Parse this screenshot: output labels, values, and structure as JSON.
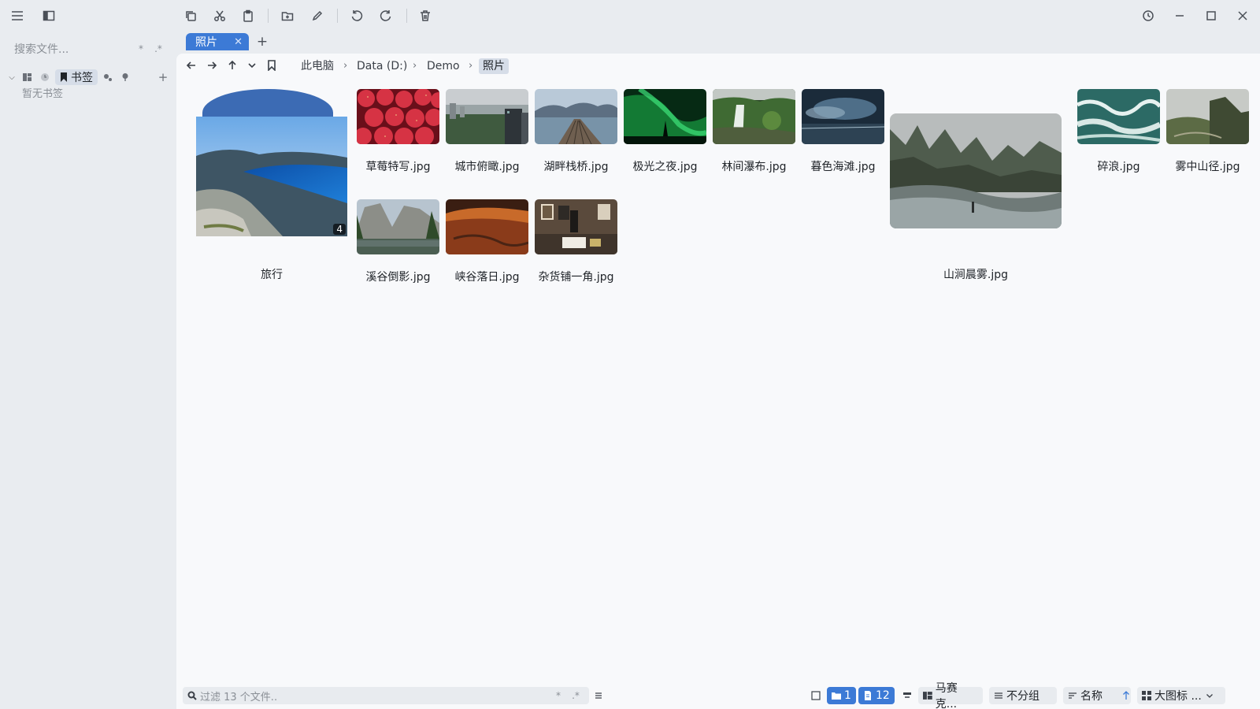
{
  "toolbar": {
    "icons": [
      "menu-icon",
      "sidebar-toggle-icon",
      "copy-icon",
      "cut-icon",
      "paste-icon",
      "new-folder-icon",
      "rename-icon",
      "undo-icon",
      "redo-icon",
      "delete-icon",
      "history-icon",
      "minimize-icon",
      "maximize-icon",
      "close-icon"
    ]
  },
  "sidebar": {
    "search_placeholder": "搜索文件...",
    "search_opt_wildcard": "*",
    "search_opt_regex": ".*",
    "bookmark_chip": "书签",
    "add": "+",
    "empty_text": "暂无书签"
  },
  "tabs": [
    {
      "label": "照片",
      "close": "✕"
    }
  ],
  "tab_add": "+",
  "breadcrumb": [
    "此电脑",
    "Data (D:)",
    "Demo",
    "照片"
  ],
  "breadcrumb_sep": "›",
  "files": [
    {
      "name": "旅行",
      "type": "folder",
      "count": "4"
    },
    {
      "name": "草莓特写.jpg"
    },
    {
      "name": "城市俯瞰.jpg"
    },
    {
      "name": "湖畔栈桥.jpg"
    },
    {
      "name": "极光之夜.jpg"
    },
    {
      "name": "林间瀑布.jpg"
    },
    {
      "name": "暮色海滩.jpg"
    },
    {
      "name": "山涧晨雾.jpg"
    },
    {
      "name": "碎浪.jpg"
    },
    {
      "name": "雾中山径.jpg"
    },
    {
      "name": "溪谷倒影.jpg"
    },
    {
      "name": "峡谷落日.jpg"
    },
    {
      "name": "杂货铺一角.jpg"
    }
  ],
  "statusbar": {
    "filter_placeholder": "过滤 13 个文件..",
    "filter_opt_wildcard": "*",
    "filter_opt_regex": ".*",
    "folder_count": "1",
    "file_count": "12",
    "layout": "马赛克...",
    "group": "不分组",
    "sort": "名称",
    "view": "大图标 ...",
    "colors": {
      "accent": "#3c7ad6",
      "chip": "#d6dde8"
    }
  }
}
